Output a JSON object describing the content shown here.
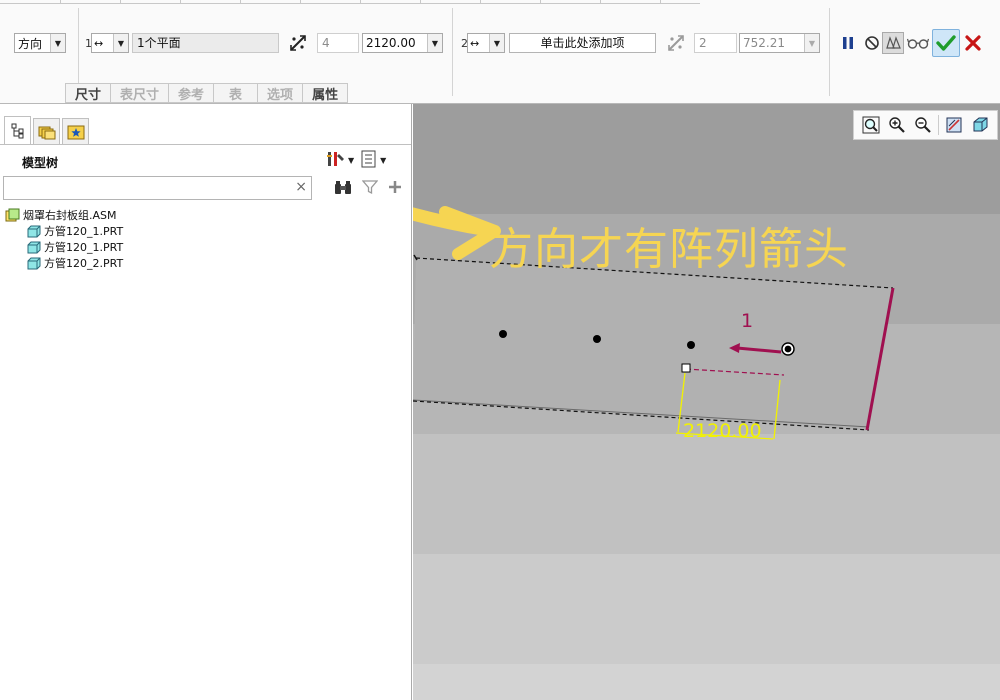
{
  "dashboard": {
    "direction_selector": "方向",
    "dir1": {
      "index": "1",
      "reference": "1个平面",
      "count": "4",
      "spacing": "2120.00"
    },
    "dir2": {
      "index": "2",
      "reference_prompt": "单击此处添加项",
      "count": "2",
      "spacing": "752.21"
    },
    "sub_tabs": [
      {
        "label": "尺寸",
        "enabled": true
      },
      {
        "label": "表尺寸",
        "enabled": false
      },
      {
        "label": "参考",
        "enabled": false
      },
      {
        "label": "表",
        "enabled": false
      },
      {
        "label": "选项",
        "enabled": false
      },
      {
        "label": "属性",
        "enabled": true
      }
    ]
  },
  "model_tree": {
    "title": "模型树",
    "search_value": "",
    "clear_icon": "×",
    "items": [
      {
        "label": "烟罩右封板组.ASM",
        "icon": "assembly-icon",
        "level": 0
      },
      {
        "label": "方管120_1.PRT",
        "icon": "part-icon",
        "level": 1
      },
      {
        "label": "方管120_1.PRT",
        "icon": "part-icon",
        "level": 1
      },
      {
        "label": "方管120_2.PRT",
        "icon": "part-icon",
        "level": 1
      }
    ]
  },
  "graphics": {
    "pattern_direction_number": "1",
    "dimension_value": "2120.00",
    "annotation_text": "方向才有阵列箭头"
  },
  "colors": {
    "annotation_yellow": "#f6d552",
    "dimension_yellow": "#f2f200",
    "pattern_maroon": "#a01050",
    "confirm_green": "#1f9d2c",
    "cancel_red": "#c71515",
    "pause_blue": "#1d3f8f"
  }
}
